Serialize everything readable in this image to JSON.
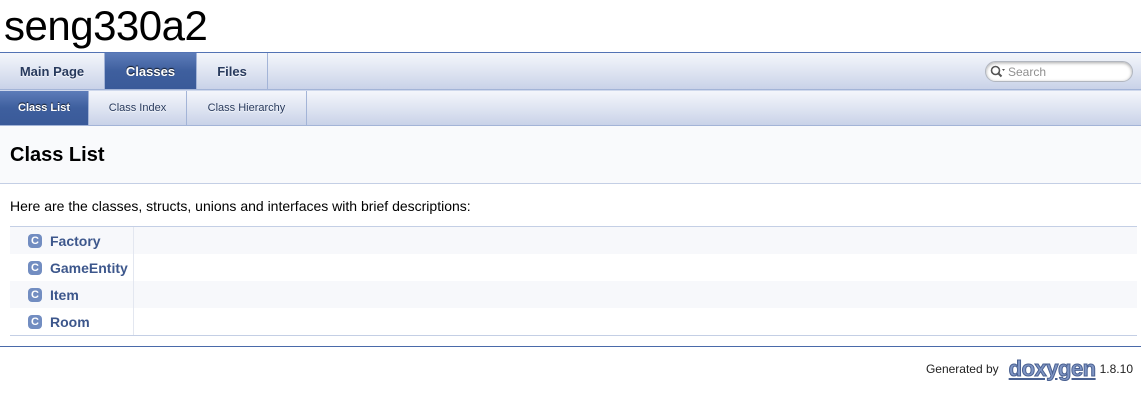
{
  "project": {
    "name": "seng330a2"
  },
  "tabs": [
    {
      "label": "Main Page",
      "current": false
    },
    {
      "label": "Classes",
      "current": true
    },
    {
      "label": "Files",
      "current": false
    }
  ],
  "subtabs": [
    {
      "label": "Class List",
      "current": true
    },
    {
      "label": "Class Index",
      "current": false
    },
    {
      "label": "Class Hierarchy",
      "current": false
    }
  ],
  "search": {
    "placeholder": "Search"
  },
  "header": {
    "title": "Class List"
  },
  "intro": "Here are the classes, structs, unions and interfaces with brief descriptions:",
  "class_icon_letter": "C",
  "classes": [
    {
      "name": "Factory",
      "description": ""
    },
    {
      "name": "GameEntity",
      "description": ""
    },
    {
      "name": "Item",
      "description": ""
    },
    {
      "name": "Room",
      "description": ""
    }
  ],
  "footer": {
    "generated_by": "Generated by",
    "logo_text": "doxygen",
    "version": "1.8.10"
  },
  "colors": {
    "accent": "#3D578C",
    "tab_current": "#3E5F9E",
    "icon_bg": "#728DC1"
  }
}
